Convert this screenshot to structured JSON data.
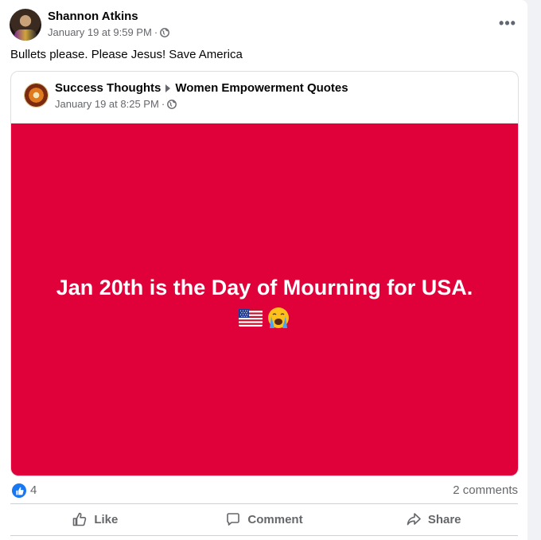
{
  "post": {
    "author": "Shannon Atkins",
    "timestamp": "January 19 at 9:59 PM",
    "audience_icon": "globe-icon",
    "text": "Bullets please. Please Jesus! Save America"
  },
  "shared_post": {
    "page_name": "Success Thoughts",
    "group_name": "Women Empowerment Quotes",
    "timestamp": "January 19 at 8:25 PM",
    "audience_icon": "globe-icon",
    "banner_text": "Jan 20th is the Day of Mourning for USA.",
    "banner_emojis": [
      "us-flag-emoji",
      "crying-face-emoji"
    ],
    "banner_color": "#e0003a"
  },
  "reactions": {
    "count": "4",
    "comments": "2 comments",
    "icon": "thumbs-up-icon"
  },
  "actions": {
    "like": "Like",
    "comment": "Comment",
    "share": "Share"
  },
  "colors": {
    "accent": "#1877f2",
    "secondary_text": "#65676b"
  }
}
